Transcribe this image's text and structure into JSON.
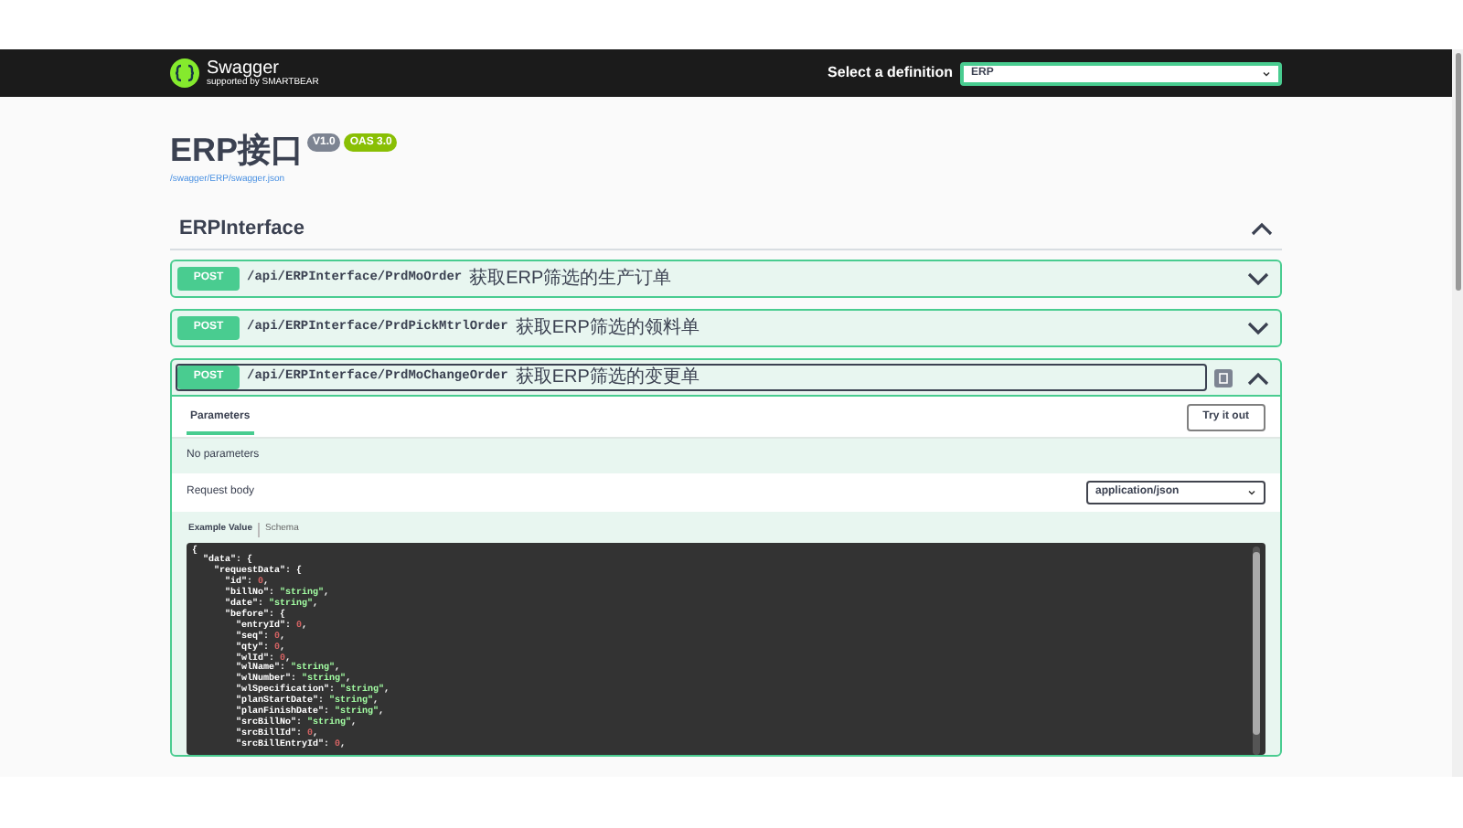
{
  "topbar": {
    "logo_text": "Swagger",
    "logo_sub": "supported by SMARTBEAR",
    "select_label": "Select a definition",
    "select_value": "ERP"
  },
  "info": {
    "title": "ERP接口",
    "version": "V1.0",
    "oas": "OAS 3.0",
    "link": "/swagger/ERP/swagger.json"
  },
  "tag": {
    "name": "ERPInterface",
    "expanded": true
  },
  "operations": [
    {
      "method": "POST",
      "path": "/api/ERPInterface/PrdMoOrder",
      "summary": "获取ERP筛选的生产订单",
      "expanded": false
    },
    {
      "method": "POST",
      "path": "/api/ERPInterface/PrdPickMtrlOrder",
      "summary": "获取ERP筛选的领料单",
      "expanded": false
    },
    {
      "method": "POST",
      "path": "/api/ERPInterface/PrdMoChangeOrder",
      "summary": "获取ERP筛选的变更单",
      "expanded": true
    }
  ],
  "detail": {
    "tab": "Parameters",
    "try_button": "Try it out",
    "no_params": "No parameters",
    "request_body": "Request body",
    "content_type": "application/json",
    "example_tabs": [
      {
        "label": "Example Value",
        "selected": true
      },
      {
        "label": "Schema",
        "selected": false
      }
    ],
    "code_lines": [
      {
        "code": "{"
      },
      {
        "code": "  \"data\": {"
      },
      {
        "code": "    \"requestData\": {"
      },
      {
        "code": "      \"id\": ",
        "value": "0",
        "kind": "number",
        "after": ","
      },
      {
        "code": "      \"billNo\": ",
        "value": "\"string\"",
        "kind": "string",
        "after": ","
      },
      {
        "code": "      \"date\": ",
        "value": "\"string\"",
        "kind": "string",
        "after": ","
      },
      {
        "code": "      \"before\": {"
      },
      {
        "code": "        \"entryId\": ",
        "value": "0",
        "kind": "number",
        "after": ","
      },
      {
        "code": "        \"seq\": ",
        "value": "0",
        "kind": "number",
        "after": ","
      },
      {
        "code": "        \"qty\": ",
        "value": "0",
        "kind": "number",
        "after": ","
      },
      {
        "code": "        \"wlId\": ",
        "value": "0",
        "kind": "number",
        "after": ","
      },
      {
        "code": "        \"wlName\": ",
        "value": "\"string\"",
        "kind": "string",
        "after": ","
      },
      {
        "code": "        \"wlNumber\": ",
        "value": "\"string\"",
        "kind": "string",
        "after": ","
      },
      {
        "code": "        \"wlSpecification\": ",
        "value": "\"string\"",
        "kind": "string",
        "after": ","
      },
      {
        "code": "        \"planStartDate\": ",
        "value": "\"string\"",
        "kind": "string",
        "after": ","
      },
      {
        "code": "        \"planFinishDate\": ",
        "value": "\"string\"",
        "kind": "string",
        "after": ","
      },
      {
        "code": "        \"srcBillNo\": ",
        "value": "\"string\"",
        "kind": "string",
        "after": ","
      },
      {
        "code": "        \"srcBillId\": ",
        "value": "0",
        "kind": "number",
        "after": ","
      },
      {
        "code": "        \"srcBillEntryId\": ",
        "value": "0",
        "kind": "number",
        "after": ","
      }
    ]
  }
}
